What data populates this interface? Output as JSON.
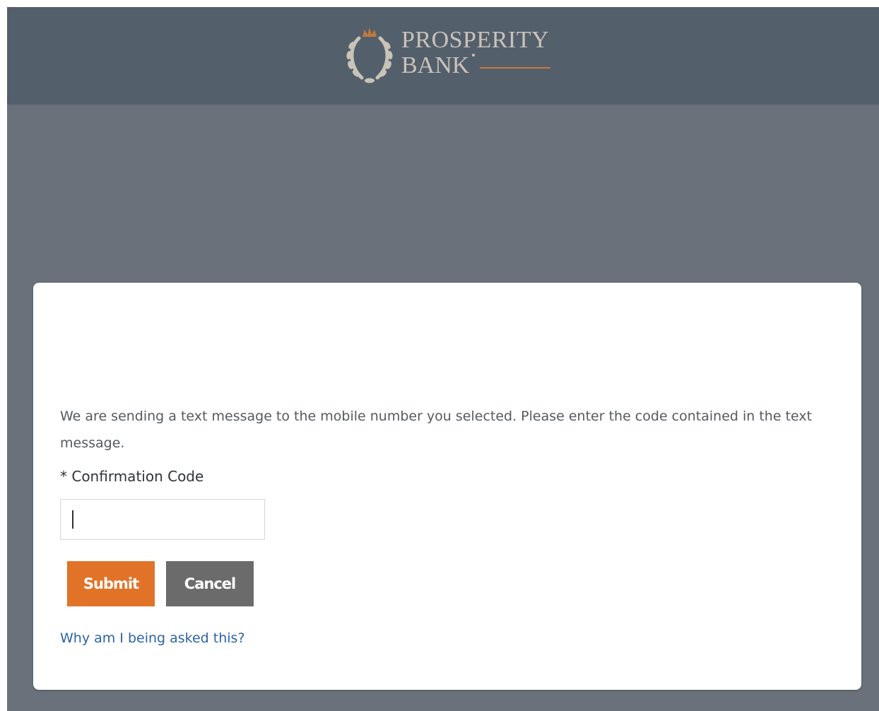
{
  "header": {
    "logo": {
      "line1": "PROSPERITY",
      "line2": "BANK",
      "icon": "laurel-wreath-crown-icon",
      "text_color": "#c9c3b8",
      "accent_color": "#c47a3a"
    },
    "background_color": "#545f6c"
  },
  "page_background_color": "#6a717b",
  "card": {
    "instructions": "We are sending a text message to the mobile number you selected. Please enter the code contained in the text message.",
    "field_label": "* Confirmation Code",
    "input": {
      "value": "",
      "placeholder": ""
    },
    "submit_label": "Submit",
    "cancel_label": "Cancel",
    "help_link": "Why am I being asked this?",
    "colors": {
      "submit": "#e07328",
      "cancel": "#6b6b6b",
      "link": "#2c63a8"
    }
  }
}
